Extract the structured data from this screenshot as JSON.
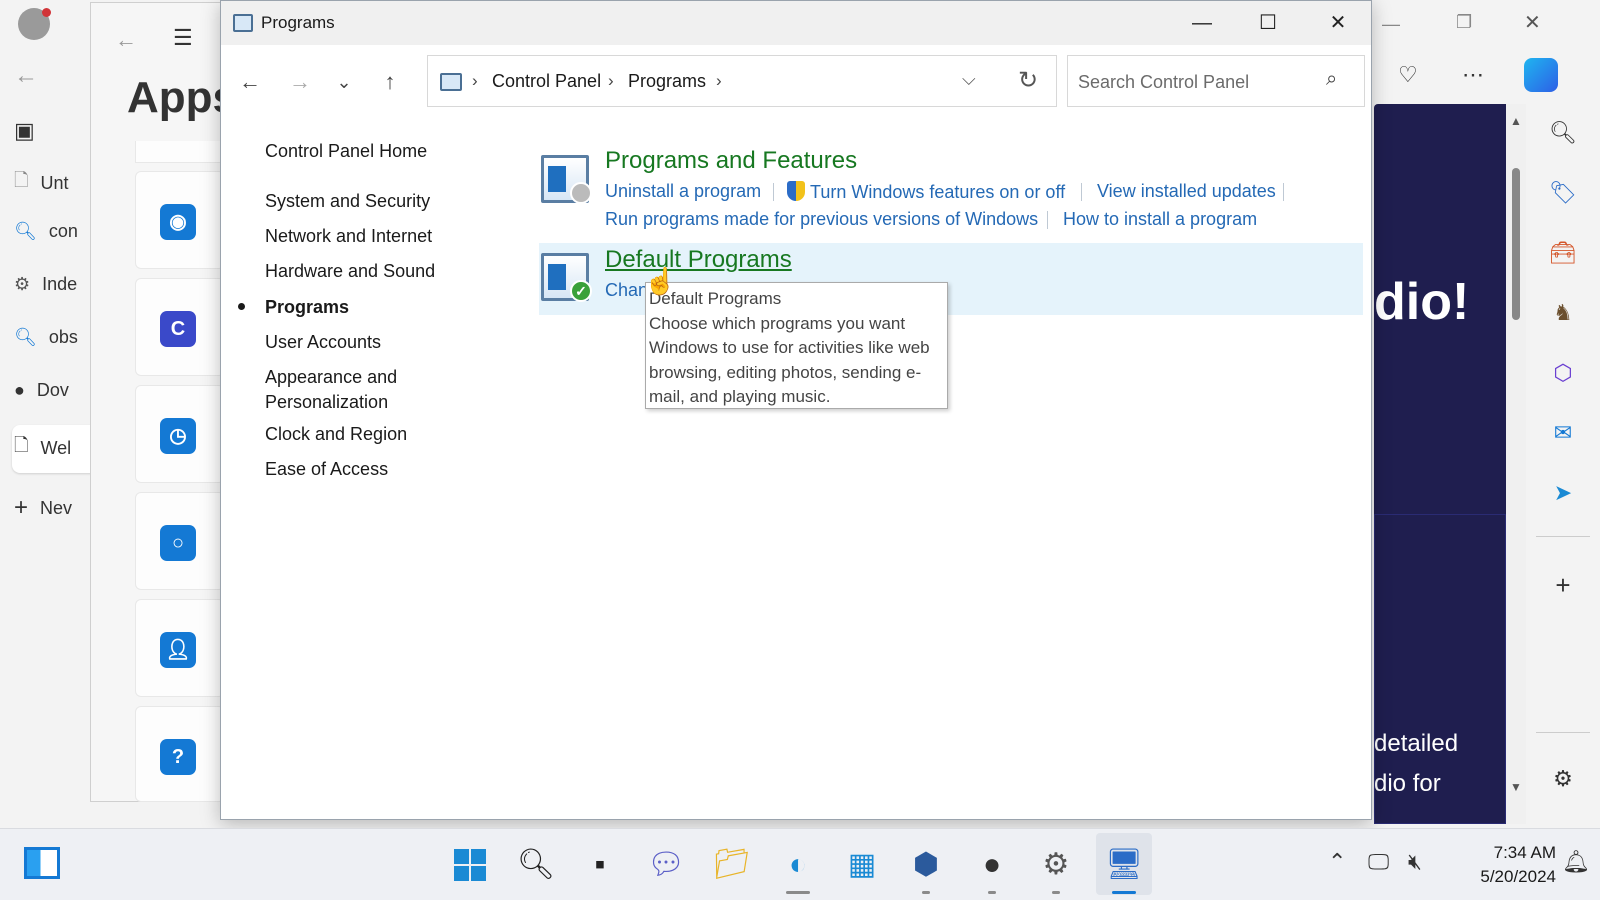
{
  "edge": {
    "left_tabs": [
      {
        "label": "Unt",
        "icon": "document-icon"
      },
      {
        "label": "con",
        "icon": "search-icon"
      },
      {
        "label": "Inde",
        "icon": "app-icon"
      },
      {
        "label": "obs",
        "icon": "search-icon"
      },
      {
        "label": "Dov",
        "icon": "obs-icon"
      },
      {
        "label": "Wel",
        "icon": "document-icon"
      },
      {
        "label": "Nev",
        "icon": "plus-icon"
      }
    ],
    "page_text": {
      "headline": "dio!",
      "line1": "detailed",
      "line2": "dio for"
    }
  },
  "settings": {
    "title": "Apps"
  },
  "window": {
    "title": "Programs",
    "controls": {
      "minimize": "—",
      "maximize": "☐",
      "close": "✕"
    }
  },
  "address": {
    "separator": "›",
    "crumbs": [
      "Control Panel",
      "Programs"
    ],
    "dropdown": "⌵",
    "refresh": "↻"
  },
  "search": {
    "placeholder": "Search Control Panel",
    "icon": "⌕"
  },
  "nav": {
    "back": "←",
    "forward": "→",
    "recent": "⌄",
    "up": "↑"
  },
  "left_nav": {
    "home": "Control Panel Home",
    "items": [
      "System and Security",
      "Network and Internet",
      "Hardware and Sound",
      "Programs",
      "User Accounts",
      "Appearance and",
      "Personalization",
      "Clock and Region",
      "Ease of Access"
    ]
  },
  "categories": {
    "features": {
      "title": "Programs and Features",
      "tasks": [
        "Uninstall a program",
        "Turn Windows features on or off",
        "View installed updates",
        "Run programs made for previous versions of Windows",
        "How to install a program"
      ]
    },
    "defaults": {
      "title": "Default Programs",
      "task_visible": "Chan"
    }
  },
  "tooltip": {
    "title": "Default Programs",
    "lines": [
      "Choose which programs you want",
      "Windows to use for activities like web",
      "browsing, editing photos, sending e-",
      "mail, and playing music."
    ]
  },
  "taskbar": {
    "time": "7:34 AM",
    "date": "5/20/2024"
  }
}
